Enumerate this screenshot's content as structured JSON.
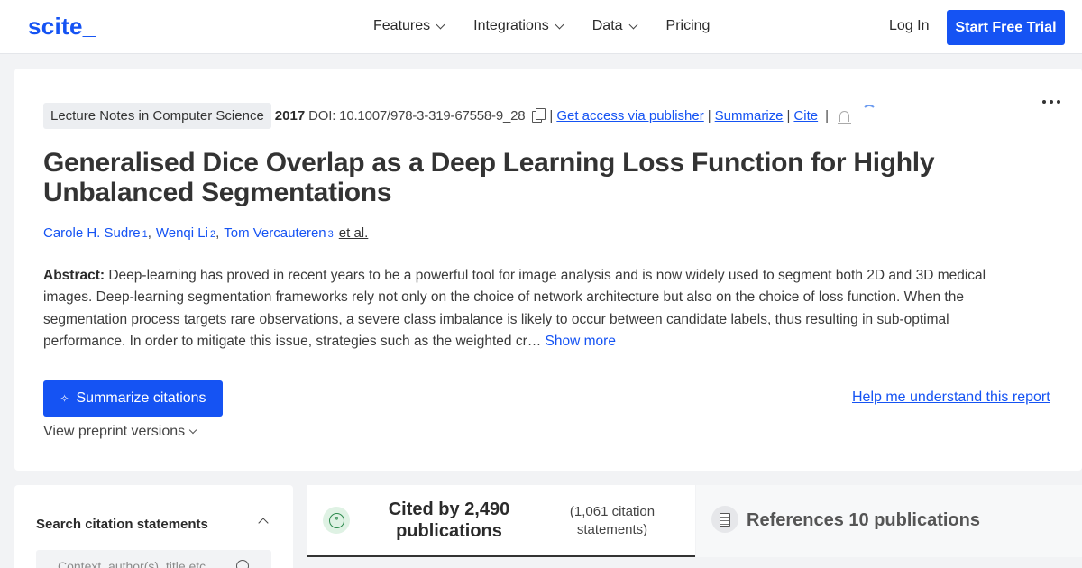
{
  "nav": {
    "logo": "scite_",
    "links": [
      "Features",
      "Integrations",
      "Data",
      "Pricing"
    ],
    "login": "Log In",
    "cta": "Start Free Trial"
  },
  "paper": {
    "journal": "Lecture Notes in Computer Science",
    "year": "2017",
    "doi": "DOI: 10.1007/978-3-319-67558-9_28",
    "links": {
      "access": "Get access via publisher",
      "summarize": "Summarize",
      "cite": "Cite"
    },
    "title": "Generalised Dice Overlap as a Deep Learning Loss Function for Highly Unbalanced Segmentations",
    "authors": [
      {
        "name": "Carole H. Sudre",
        "aff": "1"
      },
      {
        "name": "Wenqi Li",
        "aff": "2"
      },
      {
        "name": "Tom Vercauteren",
        "aff": "3"
      }
    ],
    "etal": "et al.",
    "abstract_label": "Abstract:",
    "abstract": "Deep-learning has proved in recent years to be a powerful tool for image analysis and is now widely used to segment both 2D and 3D medical images. Deep-learning segmentation frameworks rely not only on the choice of network architecture but also on the choice of loss function. When the segmentation process targets rare observations, a severe class imbalance is likely to occur between candidate labels, thus resulting in sub-optimal performance. In order to mitigate this issue, strategies such as the weighted cr…",
    "show_more": "Show more",
    "summarize_button": "Summarize citations",
    "help_link": "Help me understand this report",
    "preprint": "View preprint versions"
  },
  "sidebar": {
    "title": "Search citation statements",
    "search_placeholder": "Context, author(s), title etc"
  },
  "tabs": {
    "cited": "Cited by 2,490 publications",
    "cited_statements": "(1,061 citation statements)",
    "references": "References 10 publications"
  }
}
